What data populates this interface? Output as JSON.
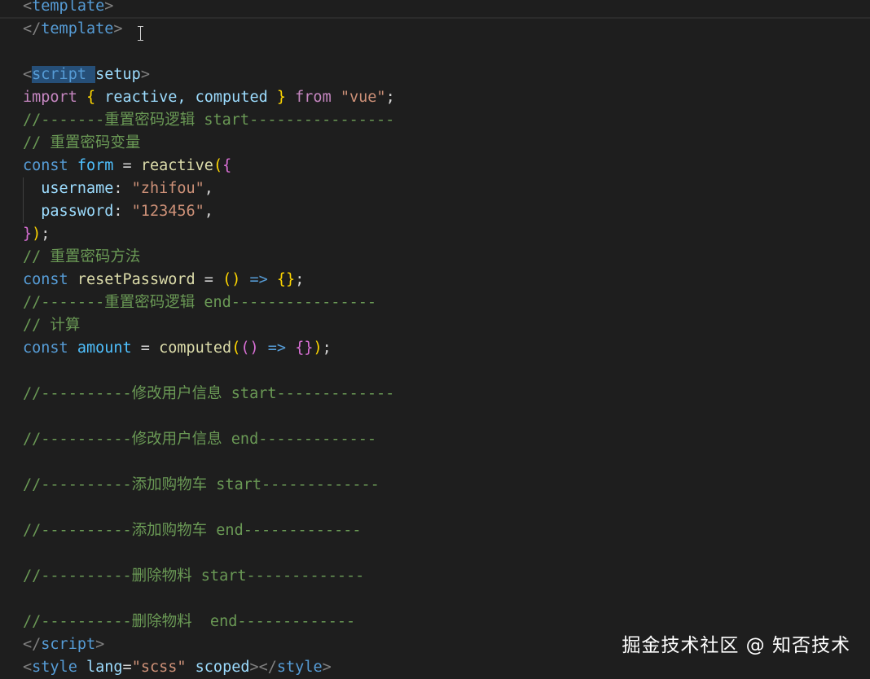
{
  "editor": {
    "lines": [
      {
        "tokens": [
          {
            "t": "<",
            "c": "punct"
          },
          {
            "t": "template",
            "c": "tag"
          },
          {
            "t": ">",
            "c": "punct"
          }
        ]
      },
      {
        "tokens": [
          {
            "t": "</",
            "c": "punct"
          },
          {
            "t": "template",
            "c": "tag"
          },
          {
            "t": ">",
            "c": "punct"
          }
        ]
      },
      {
        "tokens": []
      },
      {
        "tokens": [
          {
            "t": "<",
            "c": "punct"
          },
          {
            "t": "script ",
            "c": "tag",
            "sel": true
          },
          {
            "t": "setup",
            "c": "attr"
          },
          {
            "t": ">",
            "c": "punct"
          }
        ]
      },
      {
        "tokens": [
          {
            "t": "import",
            "c": "kw"
          },
          {
            "t": " ",
            "c": "plain"
          },
          {
            "t": "{",
            "c": "b1"
          },
          {
            "t": " reactive, computed ",
            "c": "prop"
          },
          {
            "t": "}",
            "c": "b1"
          },
          {
            "t": " ",
            "c": "plain"
          },
          {
            "t": "from",
            "c": "kw"
          },
          {
            "t": " ",
            "c": "plain"
          },
          {
            "t": "\"vue\"",
            "c": "str"
          },
          {
            "t": ";",
            "c": "plain"
          }
        ]
      },
      {
        "tokens": [
          {
            "t": "//-------重置密码逻辑 start----------------",
            "c": "comment"
          }
        ]
      },
      {
        "tokens": [
          {
            "t": "// 重置密码变量",
            "c": "comment"
          }
        ]
      },
      {
        "tokens": [
          {
            "t": "const",
            "c": "const"
          },
          {
            "t": " ",
            "c": "plain"
          },
          {
            "t": "form",
            "c": "var"
          },
          {
            "t": " = ",
            "c": "plain"
          },
          {
            "t": "reactive",
            "c": "fn"
          },
          {
            "t": "(",
            "c": "b1"
          },
          {
            "t": "{",
            "c": "b2"
          }
        ]
      },
      {
        "guide": true,
        "tokens": [
          {
            "t": "  username",
            "c": "prop"
          },
          {
            "t": ": ",
            "c": "plain"
          },
          {
            "t": "\"zhifou\"",
            "c": "str"
          },
          {
            "t": ",",
            "c": "plain"
          }
        ]
      },
      {
        "guide": true,
        "tokens": [
          {
            "t": "  password",
            "c": "prop"
          },
          {
            "t": ": ",
            "c": "plain"
          },
          {
            "t": "\"123456\"",
            "c": "str"
          },
          {
            "t": ",",
            "c": "plain"
          }
        ]
      },
      {
        "tokens": [
          {
            "t": "}",
            "c": "b2"
          },
          {
            "t": ")",
            "c": "b1"
          },
          {
            "t": ";",
            "c": "plain"
          }
        ]
      },
      {
        "tokens": [
          {
            "t": "// 重置密码方法",
            "c": "comment"
          }
        ]
      },
      {
        "tokens": [
          {
            "t": "const",
            "c": "const"
          },
          {
            "t": " ",
            "c": "plain"
          },
          {
            "t": "resetPassword",
            "c": "fn"
          },
          {
            "t": " = ",
            "c": "plain"
          },
          {
            "t": "()",
            "c": "b1"
          },
          {
            "t": " ",
            "c": "plain"
          },
          {
            "t": "=>",
            "c": "const"
          },
          {
            "t": " ",
            "c": "plain"
          },
          {
            "t": "{}",
            "c": "b1"
          },
          {
            "t": ";",
            "c": "plain"
          }
        ]
      },
      {
        "tokens": [
          {
            "t": "//-------重置密码逻辑 end----------------",
            "c": "comment"
          }
        ]
      },
      {
        "tokens": [
          {
            "t": "// 计算",
            "c": "comment"
          }
        ]
      },
      {
        "tokens": [
          {
            "t": "const",
            "c": "const"
          },
          {
            "t": " ",
            "c": "plain"
          },
          {
            "t": "amount",
            "c": "var"
          },
          {
            "t": " = ",
            "c": "plain"
          },
          {
            "t": "computed",
            "c": "fn"
          },
          {
            "t": "(",
            "c": "b1"
          },
          {
            "t": "()",
            "c": "b2"
          },
          {
            "t": " ",
            "c": "plain"
          },
          {
            "t": "=>",
            "c": "const"
          },
          {
            "t": " ",
            "c": "plain"
          },
          {
            "t": "{}",
            "c": "b2"
          },
          {
            "t": ")",
            "c": "b1"
          },
          {
            "t": ";",
            "c": "plain"
          }
        ]
      },
      {
        "tokens": []
      },
      {
        "tokens": [
          {
            "t": "//----------修改用户信息 start-------------",
            "c": "comment"
          }
        ]
      },
      {
        "tokens": []
      },
      {
        "tokens": [
          {
            "t": "//----------修改用户信息 end-------------",
            "c": "comment"
          }
        ]
      },
      {
        "tokens": []
      },
      {
        "tokens": [
          {
            "t": "//----------添加购物车 start-------------",
            "c": "comment"
          }
        ]
      },
      {
        "tokens": []
      },
      {
        "tokens": [
          {
            "t": "//----------添加购物车 end-------------",
            "c": "comment"
          }
        ]
      },
      {
        "tokens": []
      },
      {
        "tokens": [
          {
            "t": "//----------删除物料 start-------------",
            "c": "comment"
          }
        ]
      },
      {
        "tokens": []
      },
      {
        "tokens": [
          {
            "t": "//----------删除物料  end-------------",
            "c": "comment"
          }
        ]
      },
      {
        "tokens": [
          {
            "t": "</",
            "c": "punct"
          },
          {
            "t": "script",
            "c": "tag"
          },
          {
            "t": ">",
            "c": "punct"
          }
        ]
      },
      {
        "tokens": [
          {
            "t": "<",
            "c": "punct"
          },
          {
            "t": "style",
            "c": "tag"
          },
          {
            "t": " ",
            "c": "plain"
          },
          {
            "t": "lang",
            "c": "attr"
          },
          {
            "t": "=",
            "c": "plain"
          },
          {
            "t": "\"scss\"",
            "c": "str"
          },
          {
            "t": " ",
            "c": "plain"
          },
          {
            "t": "scoped",
            "c": "attr"
          },
          {
            "t": "></",
            "c": "punct"
          },
          {
            "t": "style",
            "c": "tag"
          },
          {
            "t": ">",
            "c": "punct"
          }
        ]
      }
    ]
  },
  "watermark": {
    "text": "掘金技术社区 @ 知否技术"
  },
  "colors": {
    "background": "#1e1e1e",
    "comment": "#6a9955",
    "keyword": "#c586c0",
    "string": "#ce9178",
    "function": "#dcdcaa",
    "selection": "#264f78"
  },
  "icons": {
    "cursor": "i-beam-cursor-icon"
  }
}
